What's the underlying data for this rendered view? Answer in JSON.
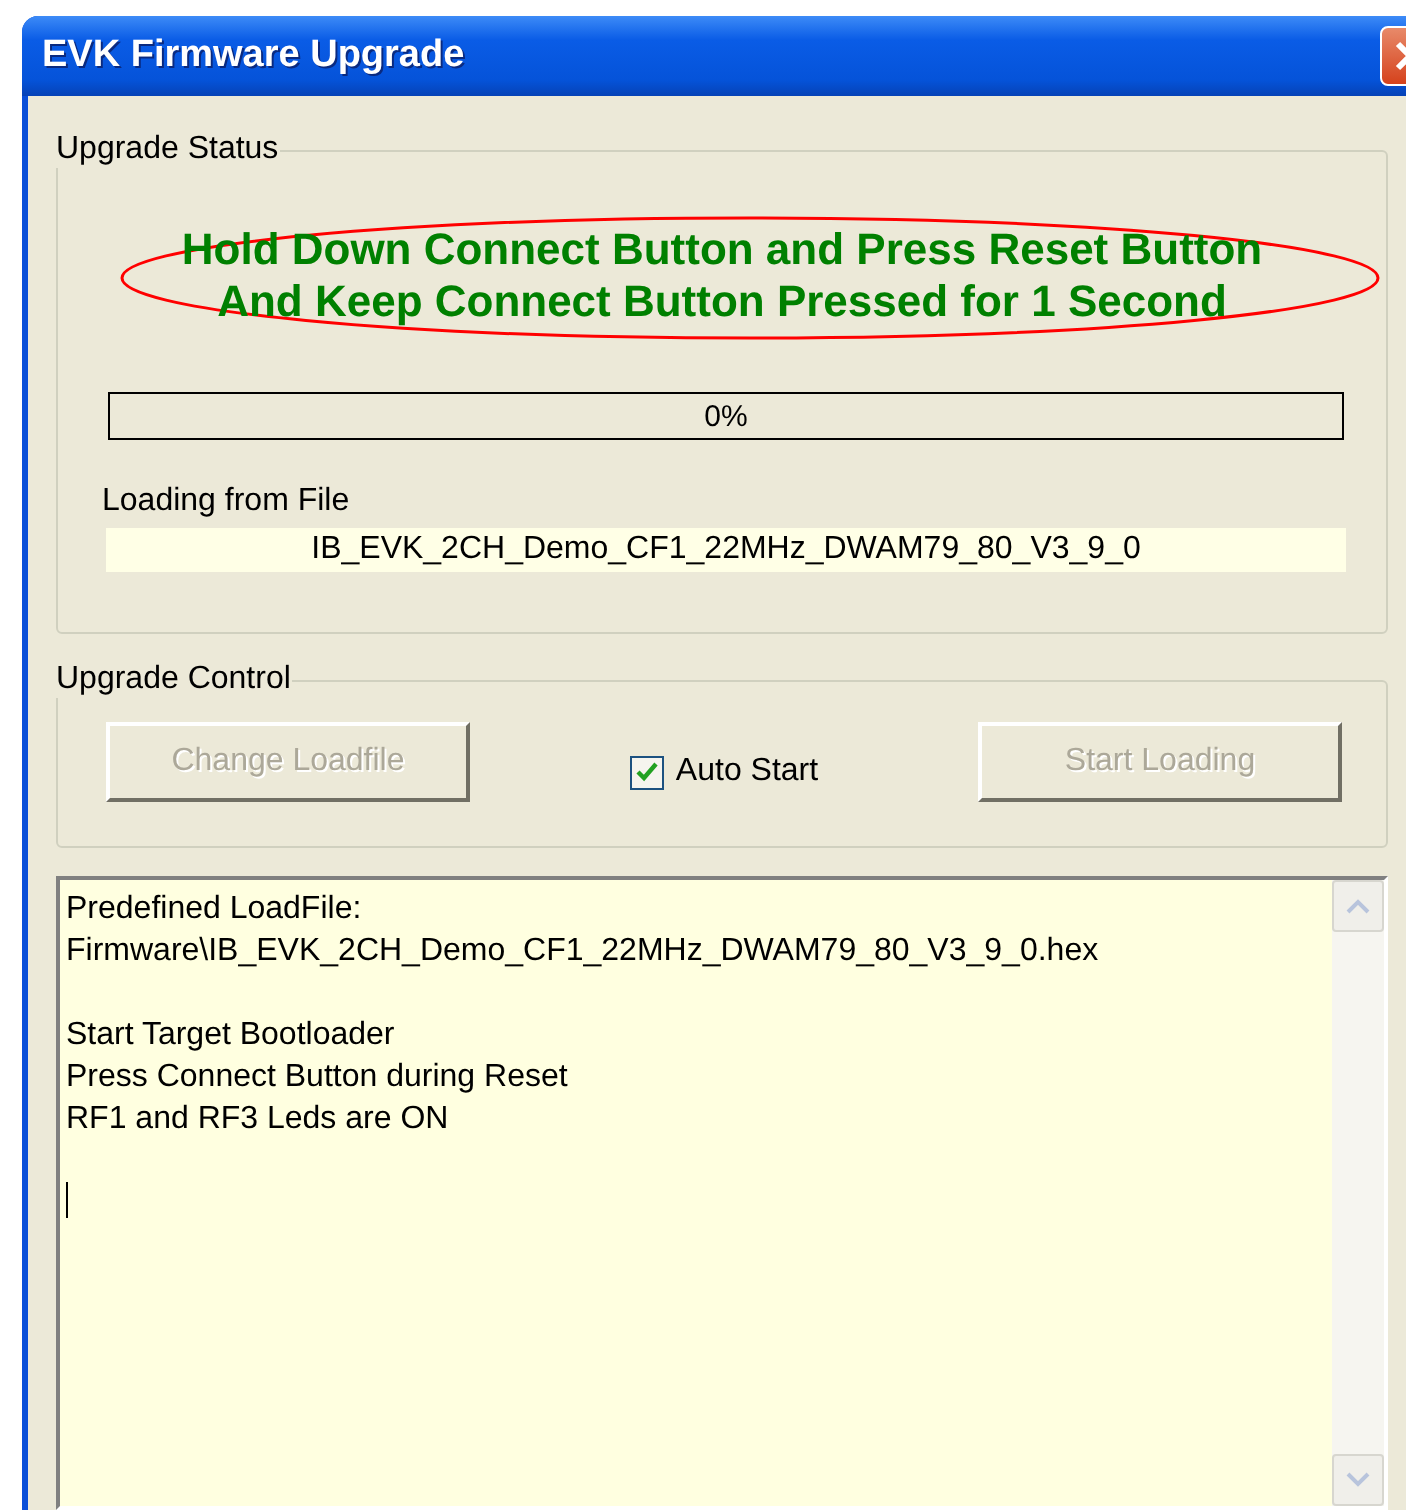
{
  "window": {
    "title": "EVK Firmware Upgrade"
  },
  "upgrade_status": {
    "legend": "Upgrade Status",
    "message_lines": [
      "Hold Down Connect Button and Press Reset Button",
      "And Keep Connect Button Pressed for 1 Second"
    ],
    "progress": {
      "level": 0,
      "label": "0%"
    },
    "file_label": "Loading from File",
    "file_name": "IB_EVK_2CH_Demo_CF1_22MHz_DWAM79_80_V3_9_0"
  },
  "upgrade_control": {
    "legend": "Upgrade Control",
    "buttons": [
      {
        "label": "Change Loadfile",
        "disabled": true
      },
      {
        "label": "Start Loading",
        "disabled": true
      }
    ],
    "auto_start": {
      "label": "Auto Start",
      "checked": true
    }
  },
  "log": {
    "paragraphs": [
      [
        "Predefined LoadFile:",
        "Firmware\\IB_EVK_2CH_Demo_CF1_22MHz_DWAM79_80_V3_9_0.hex"
      ],
      [
        "Start Target Bootloader",
        "Press Connect Button during Reset",
        "RF1 and RF3 Leds are ON"
      ]
    ],
    "cursor_visible": true
  }
}
